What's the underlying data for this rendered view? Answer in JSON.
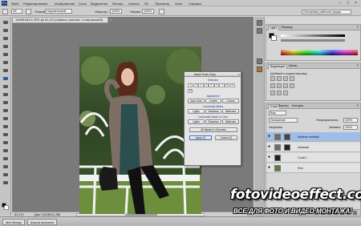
{
  "menubar": {
    "logo": "Ps",
    "items": [
      "Файл",
      "Редактирование",
      "Изображение",
      "Слои",
      "Выделение",
      "Фильтр",
      "Анализ",
      "3D",
      "Просмотр",
      "Окно",
      "Справка"
    ],
    "workspace": "Основная рабочая среда"
  },
  "options": {
    "brush_size": "25",
    "mode_label": "Режим:",
    "mode_value": "Нормальный",
    "opacity_label": "Непрозр.:",
    "opacity_value": "100%",
    "flow_label": "Нажим:",
    "flow_value": "100%"
  },
  "document": {
    "tab_title": "1DMRX81O.JPG @ 61,1% (midtone contrast, Слой-маска/8)",
    "close": "×",
    "zoom": "61,1%",
    "doc_info": "Док: 3,52M/11,3M"
  },
  "dialog": {
    "title": "Mask Tools Gary",
    "close": "×",
    "numbers": [
      "1",
      "2",
      "3",
      "4",
      "5",
      "6",
      "7",
      "8",
      "9",
      "10"
    ],
    "sections": [
      "Selection",
      "Adjustment",
      "Luminosity Masks",
      "Luminosity Masks in Color"
    ],
    "buttons_row1": [
      "Auto Tone",
      "Levels",
      "Curves"
    ],
    "buttons_row2": [
      "Lights",
      "Shadows",
      "Midtones"
    ],
    "buttons_row3": [
      "Lights",
      "Shadows",
      "Midtones"
    ],
    "opt_label": "All Masks in Channels",
    "ok": "Apply (1)",
    "cancel": "Cancel (2)"
  },
  "panels": {
    "color_tabs": [
      "Цвет",
      "Образцы"
    ],
    "adj_tabs": [
      "Коррекция",
      "Маски"
    ],
    "adj_title": "Добавить корректировку",
    "layer_tabs": [
      "Слои",
      "Каналы",
      "Контуры"
    ],
    "kind_label": "Вид",
    "blend_mode": "Умножение",
    "opacity_label": "Непрозрачность:",
    "opacity_value": "100%",
    "lock_label": "Закрепить:",
    "fill_label": "Заливка:",
    "fill_value": "100%",
    "layers": [
      {
        "name": "midtone contrast",
        "selected": true
      },
      {
        "name": "shadows",
        "selected": false
      },
      {
        "name": "Слой 1",
        "selected": false
      },
      {
        "name": "Фон",
        "selected": false
      }
    ]
  },
  "taskbar": {
    "items": [
      "Mini Bridge",
      "Шкала времени"
    ]
  },
  "watermark": {
    "logo": "fotovideoeffect.com",
    "slogan": "ВСЕ ДЛЯ ФОТО И ВИДЕО МОНТАЖА!"
  },
  "colors": {
    "accent": "#3b6fc6",
    "selection": "#9fbde8",
    "workspace_bg": "#7a7a7a",
    "dialog_header": "#1a3d8f"
  }
}
